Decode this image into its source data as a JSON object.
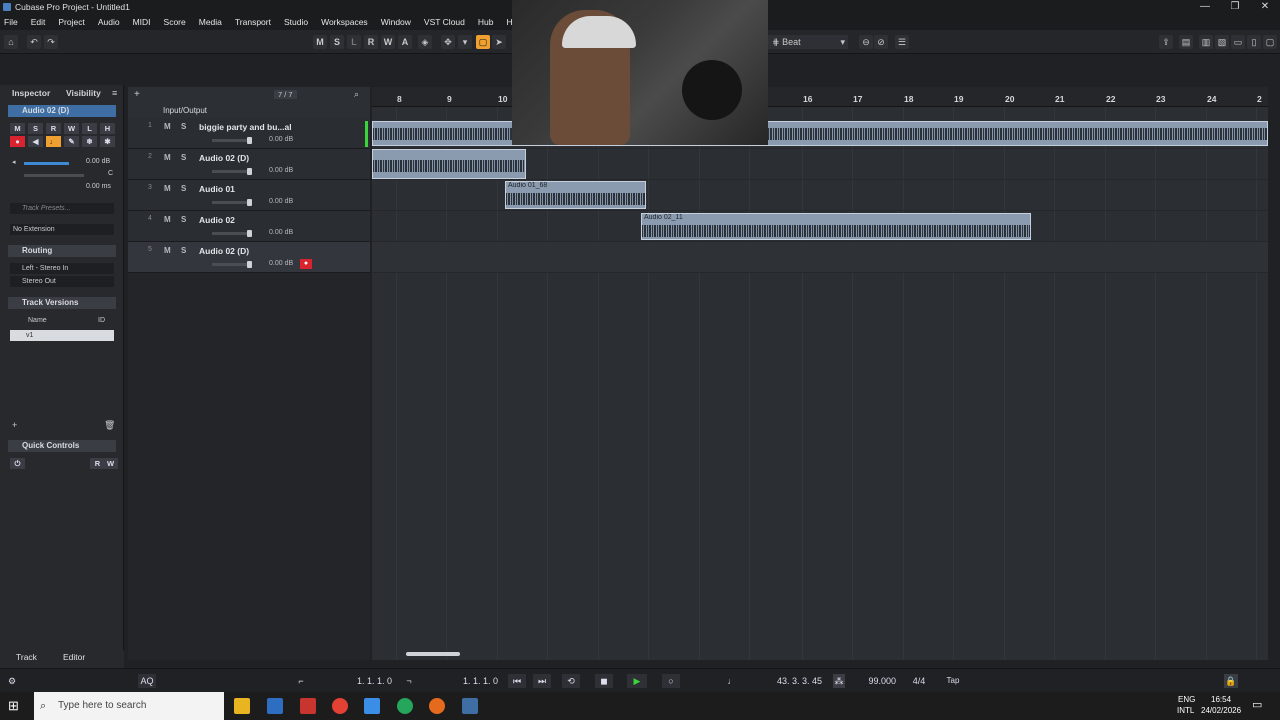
{
  "window": {
    "title": "Cubase Pro Project - Untitled1",
    "controls": [
      "—",
      "❐",
      "✕"
    ]
  },
  "menu": [
    "File",
    "Edit",
    "Project",
    "Audio",
    "MIDI",
    "Score",
    "Media",
    "Transport",
    "Studio",
    "Workspaces",
    "Window",
    "VST Cloud",
    "Hub",
    "H"
  ],
  "toolbar": {
    "state_buttons": [
      "M",
      "S",
      "L",
      "R",
      "W",
      "A"
    ],
    "grid_type": "Beat",
    "grid_icon": "grid-icon"
  },
  "inspector": {
    "tabs": [
      "Inspector",
      "Visibility"
    ],
    "track_name": "Audio 02 (D)",
    "buttons_row1": [
      "M",
      "S",
      "R",
      "W",
      "L",
      "H"
    ],
    "volume": "0.00 dB",
    "pan": "C",
    "delay": "0.00 ms",
    "track_presets": "Track Presets...",
    "extension": "No Extension",
    "routing_title": "Routing",
    "routing_in": "Left - Stereo In",
    "routing_out": "Stereo Out",
    "versions_title": "Track Versions",
    "versions_col_name": "Name",
    "versions_col_id": "ID",
    "version_item": "v1",
    "quick_controls_title": "Quick Controls",
    "qc_r": "R",
    "qc_w": "W"
  },
  "tracklist": {
    "counter": "7 / 7",
    "folder": "Input/Output",
    "tracks": [
      {
        "num": "1",
        "name": "biggie party and bu...al",
        "volume": "0.00 dB"
      },
      {
        "num": "2",
        "name": "Audio 02 (D)",
        "volume": "0.00 dB"
      },
      {
        "num": "3",
        "name": "Audio 01",
        "volume": "0.00 dB"
      },
      {
        "num": "4",
        "name": "Audio 02",
        "volume": "0.00 dB"
      },
      {
        "num": "5",
        "name": "Audio 02 (D)",
        "volume": "0.00 dB"
      }
    ],
    "ms": [
      "M",
      "S"
    ]
  },
  "ruler": {
    "bars": [
      "8",
      "9",
      "10",
      "16",
      "17",
      "18",
      "19",
      "20",
      "21",
      "22",
      "23",
      "24",
      "2"
    ]
  },
  "clips": [
    {
      "name": "Audio 01_68"
    },
    {
      "name": "Audio 02_11"
    }
  ],
  "bottom_tabs": [
    "Track",
    "Editor"
  ],
  "transport": {
    "aq": "AQ",
    "left_locator": "1. 1. 1.   0",
    "right_locator": "1. 1. 1.   0",
    "position": "43. 3. 3. 45",
    "tempo": "99.000",
    "signature": "4/4",
    "tap": "Tap"
  },
  "taskbar": {
    "search_placeholder": "Type here to search",
    "lang": "ENG",
    "layout": "INTL",
    "time": "16:54",
    "date": "24/02/2026"
  },
  "colors": {
    "record": "#d9232e",
    "play": "#3cd43c",
    "clip": "#8a9bb0",
    "accent": "#f0a030"
  }
}
